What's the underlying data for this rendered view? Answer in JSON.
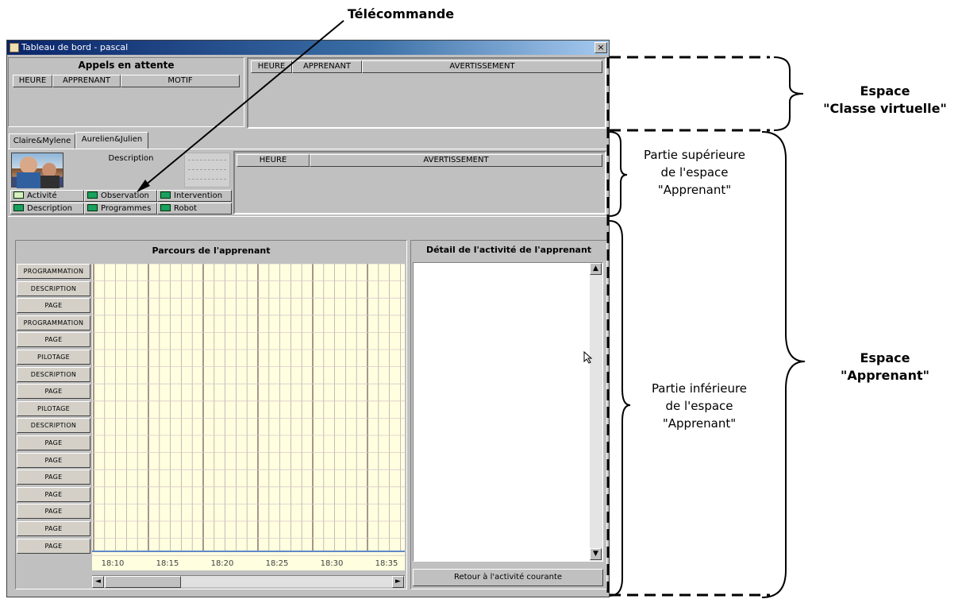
{
  "window": {
    "title": "Tableau de bord - pascal",
    "close_label": "×"
  },
  "calls": {
    "title": "Appels en attente",
    "columns": [
      "HEURE",
      "APPRENANT",
      "MOTIF"
    ]
  },
  "class_alerts": {
    "columns": [
      "HEURE",
      "APPRENANT",
      "AVERTISSEMENT"
    ]
  },
  "tabs": [
    {
      "label": "Claire&Mylene"
    },
    {
      "label": "Aurelien&Julien"
    }
  ],
  "learner": {
    "description_label": "Description"
  },
  "remote": {
    "buttons": [
      {
        "label": "Activité",
        "led": "#d8f0c0"
      },
      {
        "label": "Observation",
        "led": "#1aa060"
      },
      {
        "label": "Intervention",
        "led": "#1aa060"
      },
      {
        "label": "Description",
        "led": "#1aa060"
      },
      {
        "label": "Programmes",
        "led": "#1aa060"
      },
      {
        "label": "Robot",
        "led": "#1aa060"
      }
    ]
  },
  "learner_alerts": {
    "columns": [
      "HEURE",
      "AVERTISSEMENT"
    ]
  },
  "parcours": {
    "title": "Parcours de l'apprenant",
    "rows": [
      "PROGRAMMATION",
      "DESCRIPTION",
      "PAGE",
      "PROGRAMMATION",
      "PAGE",
      "PILOTAGE",
      "DESCRIPTION",
      "PAGE",
      "PILOTAGE",
      "DESCRIPTION",
      "PAGE",
      "PAGE",
      "PAGE",
      "PAGE",
      "PAGE",
      "PAGE",
      "PAGE"
    ],
    "times": [
      "18:10",
      "18:15",
      "18:20",
      "18:25",
      "18:30",
      "18:35"
    ],
    "scroll_left": "◄",
    "scroll_right": "►"
  },
  "detail": {
    "title": "Détail de l'activité de l'apprenant",
    "button": "Retour à l'activité courante",
    "scroll_up": "▲",
    "scroll_down": "▼"
  },
  "annotations": {
    "telecommande": "Télécommande",
    "classe_line1": "Espace",
    "classe_line2": "\"Classe virtuelle\"",
    "sup_line1": "Partie supérieure",
    "sup_line2": "de l'espace",
    "sup_line3": "\"Apprenant\"",
    "inf_line1": "Partie inférieure",
    "inf_line2": "de l'espace",
    "inf_line3": "\"Apprenant\"",
    "app_line1": "Espace",
    "app_line2": "\"Apprenant\""
  },
  "colors": {
    "title_bar": "#0a246a",
    "timeline_bg": "#ffffe0",
    "timeline_line": "#5f88c8",
    "led_green": "#1aa060"
  }
}
